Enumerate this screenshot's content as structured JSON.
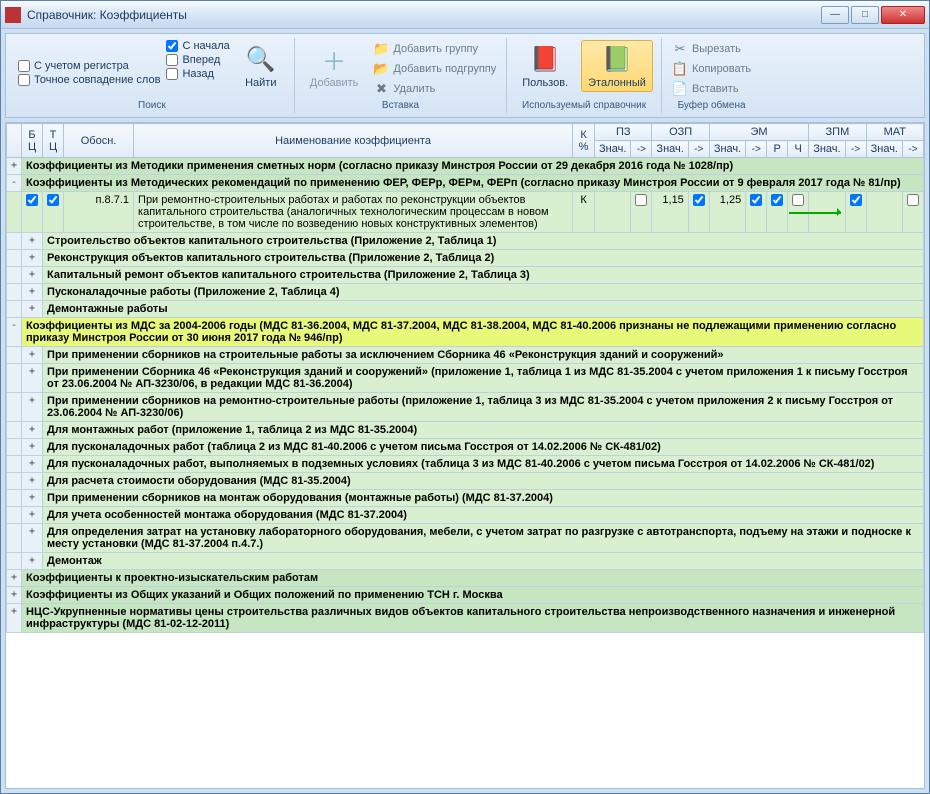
{
  "window": {
    "title": "Справочник: Коэффициенты"
  },
  "ribbon": {
    "search": {
      "opt_register": "С учетом регистра",
      "opt_exact": "Точное совпадение слов",
      "opt_start": "С начала",
      "opt_forward": "Вперед",
      "opt_back": "Назад",
      "find": "Найти",
      "label": "Поиск"
    },
    "insert": {
      "add": "Добавить",
      "add_group": "Добавить группу",
      "add_subgroup": "Добавить подгруппу",
      "delete": "Удалить",
      "label": "Вставка"
    },
    "book": {
      "user": "Пользов.",
      "reference": "Эталонный",
      "label": "Используемый справочник"
    },
    "clipboard": {
      "cut": "Вырезать",
      "copy": "Копировать",
      "paste": "Вставить",
      "label": "Буфер обмена"
    }
  },
  "headers": {
    "bc": "Б\nЦ",
    "tc": "Т\nЦ",
    "obos": "Обосн.",
    "name": "Наименование коэффициента",
    "kpct": "К\n%",
    "pz": "ПЗ",
    "ozp": "ОЗП",
    "em": "ЭМ",
    "zpm": "ЗПМ",
    "mat": "МАТ",
    "znach": "Знач.",
    "arrow": "->",
    "r": "Р",
    "ch": "Ч"
  },
  "rows": [
    {
      "type": "group",
      "exp": "+",
      "text": "Коэффициенты из Методики применения сметных норм (согласно приказу Минстроя России от 29 декабря 2016 года № 1028/пр)"
    },
    {
      "type": "group",
      "exp": "-",
      "text": "Коэффициенты из Методических рекомендаций по применению ФЕР, ФЕРр, ФЕРм, ФЕРп (согласно приказу Минстроя России от 9 февраля 2017 года № 81/пр)"
    },
    {
      "type": "data",
      "obos": "п.8.7.1",
      "name": "При ремонтно-строительных работах и работах по реконструкции объектов капитального строительства (аналогичных технологическим процессам в новом строительстве, в том числе по возведению новых конструктивных элементов)",
      "k": "К",
      "ozp": "1,15",
      "em": "1,25"
    },
    {
      "type": "sub",
      "exp": "+",
      "text": "Строительство объектов капитального строительства (Приложение 2, Таблица 1)"
    },
    {
      "type": "sub",
      "exp": "+",
      "text": "Реконструкция объектов капитального строительства (Приложение 2, Таблица 2)"
    },
    {
      "type": "sub",
      "exp": "+",
      "text": "Капитальный ремонт объектов капитального строительства (Приложение 2, Таблица 3)"
    },
    {
      "type": "sub",
      "exp": "+",
      "text": "Пусконаладочные работы (Приложение 2, Таблица 4)"
    },
    {
      "type": "sub",
      "exp": "+",
      "text": "Демонтажные работы"
    },
    {
      "type": "group",
      "exp": "-",
      "hl": true,
      "text": "Коэффициенты из МДС за 2004-2006 годы (МДС 81-36.2004, МДС 81-37.2004, МДС 81-38.2004, МДС 81-40.2006 признаны не подлежащими применению согласно приказу Минстроя России от 30 июня 2017 года № 946/пр)"
    },
    {
      "type": "sub",
      "exp": "+",
      "text": "При применении сборников на строительные работы за исключением Сборника 46 «Реконструкция зданий и сооружений»"
    },
    {
      "type": "sub",
      "exp": "+",
      "text": "При применении Сборника 46 «Реконструкция зданий и сооружений» (приложение 1, таблица 1 из МДС 81-35.2004 с учетом приложения 1 к письму Госстроя от 23.06.2004 № АП-3230/06, в редакции МДС 81-36.2004)"
    },
    {
      "type": "sub",
      "exp": "+",
      "text": "При применении сборников на ремонтно-строительные работы (приложение 1, таблица 3 из МДС 81-35.2004 с учетом приложения 2 к письму Госстроя от 23.06.2004 № АП-3230/06)"
    },
    {
      "type": "sub",
      "exp": "+",
      "text": "Для монтажных работ (приложение 1, таблица 2 из МДС 81-35.2004)"
    },
    {
      "type": "sub",
      "exp": "+",
      "text": "Для пусконаладочных работ (таблица 2 из МДС 81-40.2006 с учетом письма Госстроя от 14.02.2006 № СК-481/02)"
    },
    {
      "type": "sub",
      "exp": "+",
      "text": "Для пусконаладочных работ, выполняемых в подземных условиях (таблица 3 из МДС 81-40.2006 с учетом письма Госстроя от 14.02.2006 № СК-481/02)"
    },
    {
      "type": "sub",
      "exp": "+",
      "text": "Для расчета стоимости оборудования (МДС 81-35.2004)"
    },
    {
      "type": "sub",
      "exp": "+",
      "text": "При применении сборников на монтаж оборудования (монтажные работы) (МДС 81-37.2004)"
    },
    {
      "type": "sub",
      "exp": "+",
      "text": "Для учета особенностей монтажа оборудования (МДС 81-37.2004)"
    },
    {
      "type": "sub",
      "exp": "+",
      "text": "Для определения затрат на установку лабораторного оборудования, мебели, с учетом затрат по разгрузке с автотранспорта, подъему на этажи и подноске к месту установки (МДС 81-37.2004 п.4.7.)"
    },
    {
      "type": "sub",
      "exp": "+",
      "text": "Демонтаж"
    },
    {
      "type": "group",
      "exp": "+",
      "text": "Коэффициенты к проектно-изыскательским работам"
    },
    {
      "type": "group",
      "exp": "+",
      "text": "Коэффициенты из Общих указаний и Общих положений по применению ТСН г. Москва"
    },
    {
      "type": "group",
      "exp": "+",
      "text": "НЦС-Укрупненные нормативы цены строительства различных видов объектов капитального строительства непроизводственного назначения и инженерной инфраструктуры (МДС 81-02-12-2011)"
    }
  ]
}
